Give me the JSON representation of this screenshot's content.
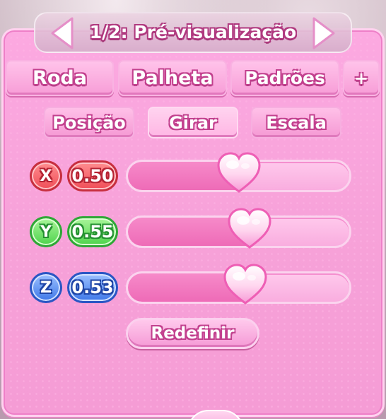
{
  "header": {
    "title": "1/2: Pré-visualização"
  },
  "tabs": [
    {
      "id": "roda",
      "label": "Roda"
    },
    {
      "id": "palheta",
      "label": "Palheta"
    },
    {
      "id": "padroes",
      "label": "Padrões"
    },
    {
      "id": "plus",
      "label": "+"
    }
  ],
  "subtabs": [
    {
      "id": "posicao",
      "label": "Posição",
      "active": false
    },
    {
      "id": "girar",
      "label": "Girar",
      "active": true
    },
    {
      "id": "escala",
      "label": "Escala",
      "active": false
    }
  ],
  "axes": [
    {
      "axis": "X",
      "value": "0.50",
      "level": 0.5,
      "color": "#f04e58"
    },
    {
      "axis": "Y",
      "value": "0.55",
      "level": 0.55,
      "color": "#4ed34c"
    },
    {
      "axis": "Z",
      "value": "0.53",
      "level": 0.53,
      "color": "#3e77e8"
    }
  ],
  "reset_label": "Redefinir",
  "colors": {
    "panel": "#f7a2d9",
    "accent": "#c2408e",
    "slider_fill": "#ee6bb7"
  },
  "icons": {
    "prev": "arrow-left-icon",
    "next": "arrow-right-icon",
    "thumb": "heart-icon"
  }
}
